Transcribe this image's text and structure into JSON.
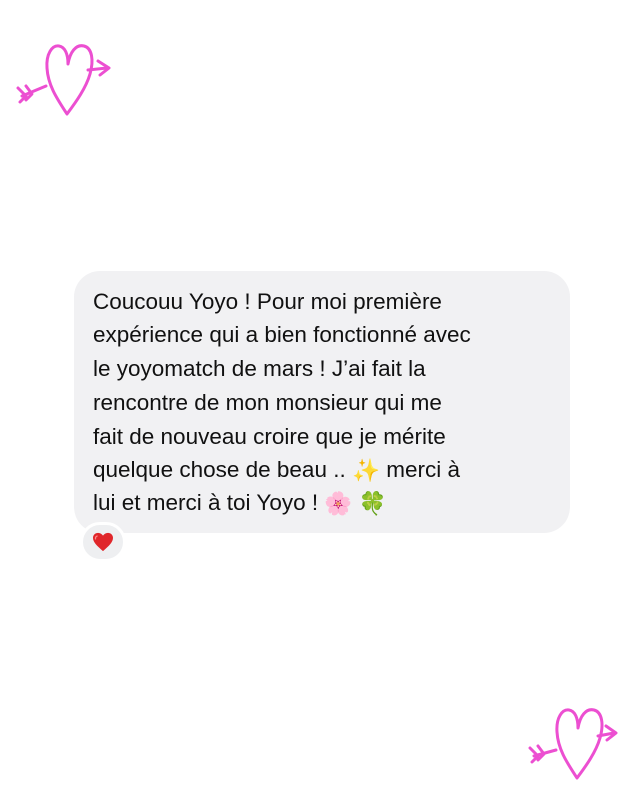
{
  "message": {
    "lines": [
      "Coucouu Yoyo ! Pour moi première",
      "expérience qui a bien fonctionné avec",
      "le yoyomatch de mars ! J’ai fait la",
      "rencontre de mon monsieur qui me",
      "fait de nouveau croire que je mérite",
      "quelque chose de beau .. ",
      "lui et merci à toi Yoyo ! "
    ],
    "line6_after_emoji": " merci à",
    "emojis": {
      "sparkles": "✨",
      "flower": "🌸",
      "clover": "🍀"
    }
  },
  "reaction": {
    "icon": "red-heart-icon",
    "color": "#e0262a"
  },
  "decorations": {
    "icon": "heart-arrow-doodle-icon",
    "color": "#ec4fd1"
  }
}
